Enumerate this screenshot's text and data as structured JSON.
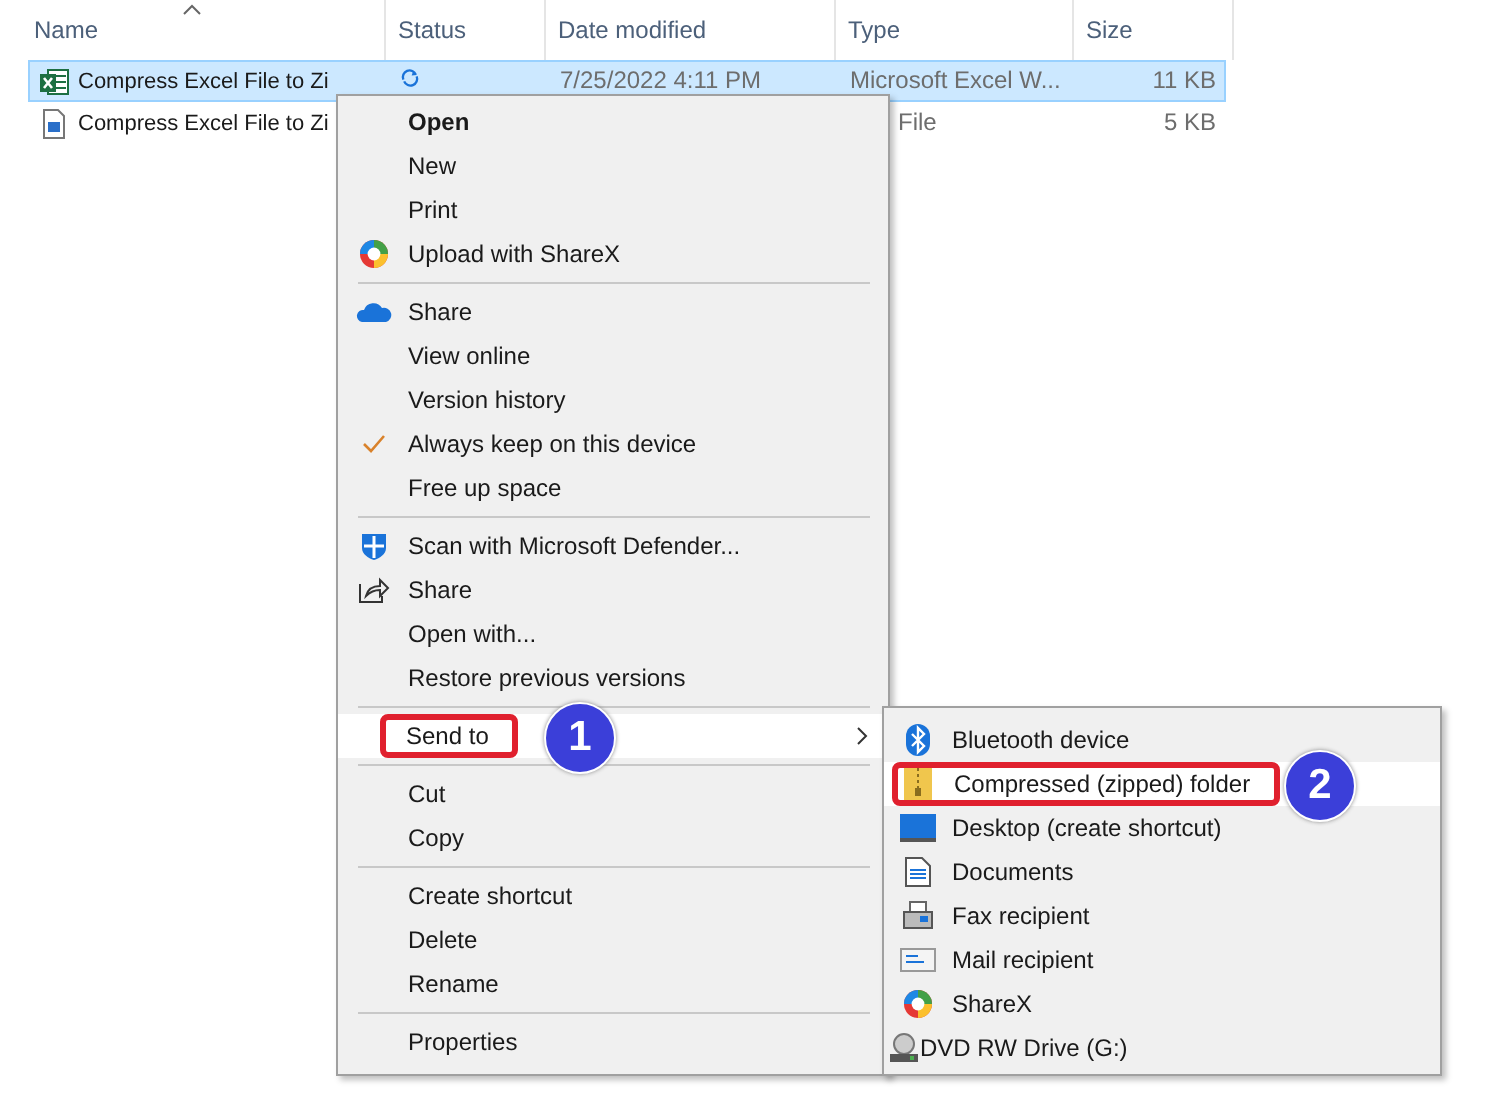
{
  "columns": [
    {
      "label": "Name",
      "sorted": true
    },
    {
      "label": "Status",
      "sorted": false
    },
    {
      "label": "Date modified",
      "sorted": false
    },
    {
      "label": "Type",
      "sorted": false
    },
    {
      "label": "Size",
      "sorted": false
    }
  ],
  "files": [
    {
      "name": "Compress Excel File to Zi",
      "date": "7/25/2022 4:11 PM",
      "type": "Microsoft Excel W...",
      "size": "11 KB",
      "selected": true,
      "synced": true
    },
    {
      "name": "Compress Excel File to Zi",
      "type": "File",
      "size": "5 KB",
      "selected": false
    }
  ],
  "context_menu": [
    {
      "kind": "item",
      "label": "Open",
      "bold": true,
      "checked": false,
      "selected": false
    },
    {
      "kind": "item",
      "label": "New",
      "bold": false,
      "checked": false,
      "selected": false
    },
    {
      "kind": "item",
      "label": "Print",
      "bold": false,
      "checked": false,
      "selected": false
    },
    {
      "kind": "item",
      "label": "Upload with ShareX",
      "bold": false,
      "checked": false,
      "selected": false
    },
    {
      "kind": "separator"
    },
    {
      "kind": "item",
      "label": "Share",
      "bold": false,
      "checked": false,
      "selected": false
    },
    {
      "kind": "item",
      "label": "View online",
      "bold": false,
      "checked": false,
      "selected": false
    },
    {
      "kind": "item",
      "label": "Version history",
      "bold": false,
      "checked": false,
      "selected": false
    },
    {
      "kind": "item",
      "label": "Always keep on this device",
      "bold": false,
      "checked": true,
      "selected": false
    },
    {
      "kind": "item",
      "label": "Free up space",
      "bold": false,
      "checked": false,
      "selected": false
    },
    {
      "kind": "separator"
    },
    {
      "kind": "item",
      "label": "Scan with Microsoft Defender...",
      "bold": false,
      "checked": false,
      "selected": false
    },
    {
      "kind": "item",
      "label": "Share",
      "bold": false,
      "checked": false,
      "selected": false
    },
    {
      "kind": "item",
      "label": "Open with...",
      "bold": false,
      "checked": false,
      "selected": false
    },
    {
      "kind": "item",
      "label": "Restore previous versions",
      "bold": false,
      "checked": false,
      "selected": false
    },
    {
      "kind": "separator"
    },
    {
      "kind": "item",
      "label": "Send to",
      "bold": false,
      "checked": false,
      "selected": true,
      "submenu": true,
      "callout": "1"
    },
    {
      "kind": "separator"
    },
    {
      "kind": "item",
      "label": "Cut",
      "bold": false,
      "checked": false,
      "selected": false
    },
    {
      "kind": "item",
      "label": "Copy",
      "bold": false,
      "checked": false,
      "selected": false
    },
    {
      "kind": "separator"
    },
    {
      "kind": "item",
      "label": "Create shortcut",
      "bold": false,
      "checked": false,
      "selected": false
    },
    {
      "kind": "item",
      "label": "Delete",
      "bold": false,
      "checked": false,
      "selected": false
    },
    {
      "kind": "item",
      "label": "Rename",
      "bold": false,
      "checked": false,
      "selected": false
    },
    {
      "kind": "separator"
    },
    {
      "kind": "item",
      "label": "Properties",
      "bold": false,
      "checked": false,
      "selected": false
    }
  ],
  "send_to_menu": [
    {
      "label": "Bluetooth device",
      "selected": false
    },
    {
      "label": "Compressed (zipped) folder",
      "selected": true,
      "callout": "2"
    },
    {
      "label": "Desktop (create shortcut)",
      "selected": false
    },
    {
      "label": "Documents",
      "selected": false
    },
    {
      "label": "Fax recipient",
      "selected": false
    },
    {
      "label": "Mail recipient",
      "selected": false
    },
    {
      "label": "ShareX",
      "selected": false
    },
    {
      "label": "DVD RW Drive (G:)",
      "selected": false
    }
  ]
}
